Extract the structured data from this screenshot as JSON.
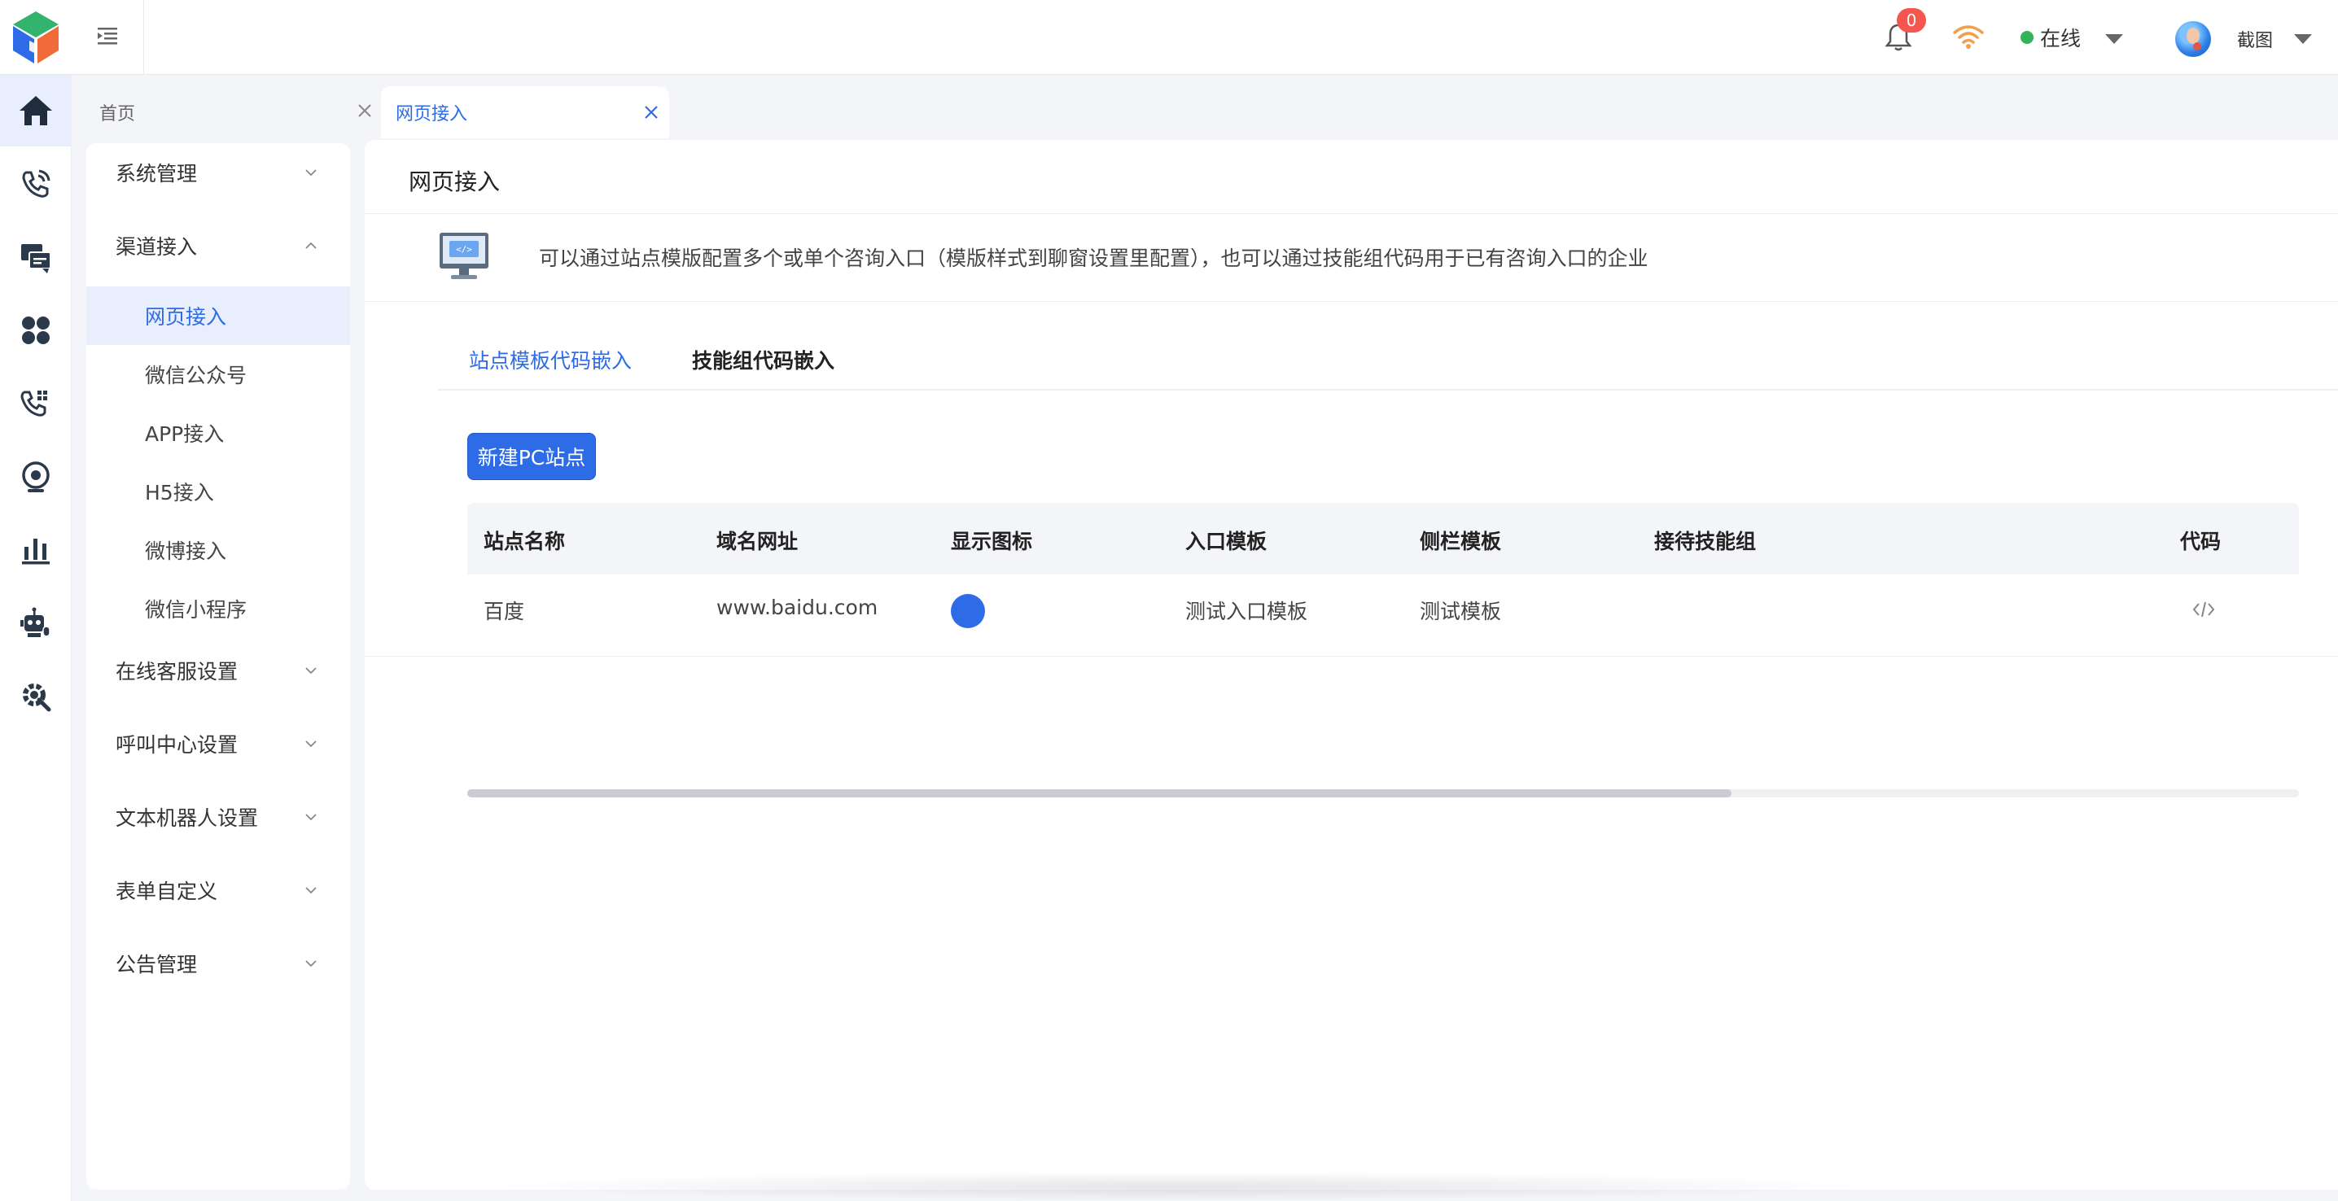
{
  "header": {
    "notification_count": "0",
    "status_label": "在线",
    "status_color": "#35b35b",
    "username": "截图"
  },
  "rail": {
    "icons": [
      "home-icon",
      "phone-call-icon",
      "chat-icon",
      "apps-icon",
      "phone-dialpad-icon",
      "monitor-icon",
      "bar-chart-icon",
      "robot-icon",
      "settings-icon"
    ],
    "active_index": 0
  },
  "tabs": [
    {
      "label": "首页",
      "active": false
    },
    {
      "label": "网页接入",
      "active": true
    }
  ],
  "sidebar": {
    "items": [
      {
        "label": "系统管理",
        "expanded": false
      },
      {
        "label": "渠道接入",
        "expanded": true,
        "children": [
          {
            "label": "网页接入",
            "active": true
          },
          {
            "label": "微信公众号"
          },
          {
            "label": "APP接入"
          },
          {
            "label": "H5接入"
          },
          {
            "label": "微博接入"
          },
          {
            "label": "微信小程序"
          }
        ]
      },
      {
        "label": "在线客服设置",
        "expanded": false
      },
      {
        "label": "呼叫中心设置",
        "expanded": false
      },
      {
        "label": "文本机器人设置",
        "expanded": false
      },
      {
        "label": "表单自定义",
        "expanded": false
      },
      {
        "label": "公告管理",
        "expanded": false
      }
    ]
  },
  "main": {
    "title": "网页接入",
    "notice": "可以通过站点模版配置多个或单个咨询入口（模版样式到聊窗设置里配置），也可以通过技能组代码用于已有咨询入口的企业",
    "subtabs": [
      {
        "label": "站点模板代码嵌入",
        "active": true
      },
      {
        "label": "技能组代码嵌入",
        "active": false
      }
    ],
    "new_button": "新建PC站点",
    "table": {
      "columns": [
        "站点名称",
        "域名网址",
        "显示图标",
        "入口模板",
        "侧栏模板",
        "接待技能组",
        "代码"
      ],
      "rows": [
        {
          "name": "百度",
          "domain": "www.baidu.com",
          "icon_color": "#2e6be6",
          "entry_template": "测试入口模板",
          "sidebar_template": "测试模板",
          "skill_group": "",
          "code_icon": "code-icon"
        }
      ],
      "scroll_fraction": 0.69
    }
  },
  "colors": {
    "accent": "#2e6be6",
    "active_bg": "#e8eefb",
    "badge": "#f5574f"
  }
}
